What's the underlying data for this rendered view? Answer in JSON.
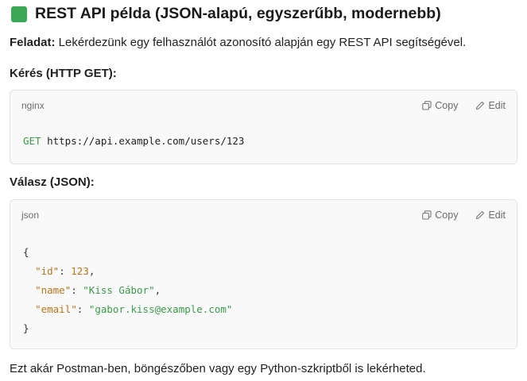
{
  "heading": {
    "title": "REST API példa (JSON-alapú, egyszerűbb, modernebb)"
  },
  "task": {
    "label": "Feladat:",
    "text": " Lekérdezünk egy felhasználót azonosító alapján egy REST API segítségével."
  },
  "request": {
    "label": "Kérés (HTTP GET):",
    "lang": "nginx",
    "method": "GET",
    "url": " https://api.example.com/users/123"
  },
  "response": {
    "label": "Válasz (JSON):",
    "lang": "json",
    "open_brace": "{",
    "close_brace": "}",
    "fields": [
      {
        "key": "\"id\"",
        "value": "123",
        "trail": ","
      },
      {
        "key": "\"name\"",
        "value": "\"Kiss Gábor\"",
        "trail": ","
      },
      {
        "key": "\"email\"",
        "value": "\"gabor.kiss@example.com\"",
        "trail": ""
      }
    ]
  },
  "actions": {
    "copy": "Copy",
    "edit": "Edit"
  },
  "footer": {
    "text": "Ezt akár Postman-ben, böngészőben vagy egy Python-szkriptből is lekérheted."
  }
}
